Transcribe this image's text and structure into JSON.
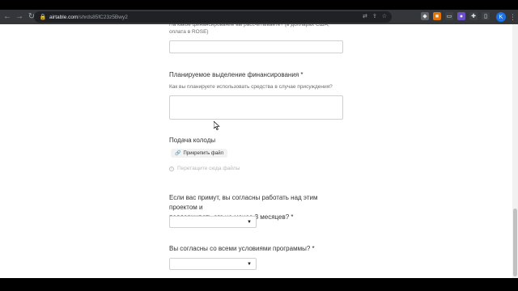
{
  "browser": {
    "url_host": "airtable.com",
    "url_path": "/shrds85fC23z5Bwy2",
    "profile_initial": "K"
  },
  "form": {
    "funding_question_partial": "На какое финансирование вы рассчитываете? (в долларах США, оплата в ROSE)",
    "allocation": {
      "label": "Планируемое выделение финансирования",
      "required_mark": "*",
      "description": "Как вы планируете использовать средства в случае присуждения?"
    },
    "deck": {
      "label": "Подача колоды",
      "attach_label": "Прикрепить файл",
      "drop_hint": "Перетащите сюда файлы"
    },
    "commitment": {
      "label_line1": "Если вас примут, вы согласны работать над этим проектом и",
      "label_line2": "поддерживать его не менее 3 месяцев?",
      "required_mark": "*"
    },
    "terms": {
      "label": "Вы согласны со всеми условиями программы?",
      "required_mark": "*"
    }
  },
  "icons": {
    "back": "back-arrow-icon",
    "forward": "forward-arrow-icon",
    "reload": "reload-icon",
    "lock": "lock-icon",
    "paperclip": "paperclip-icon",
    "info": "info-icon",
    "caret": "caret-down-icon"
  }
}
